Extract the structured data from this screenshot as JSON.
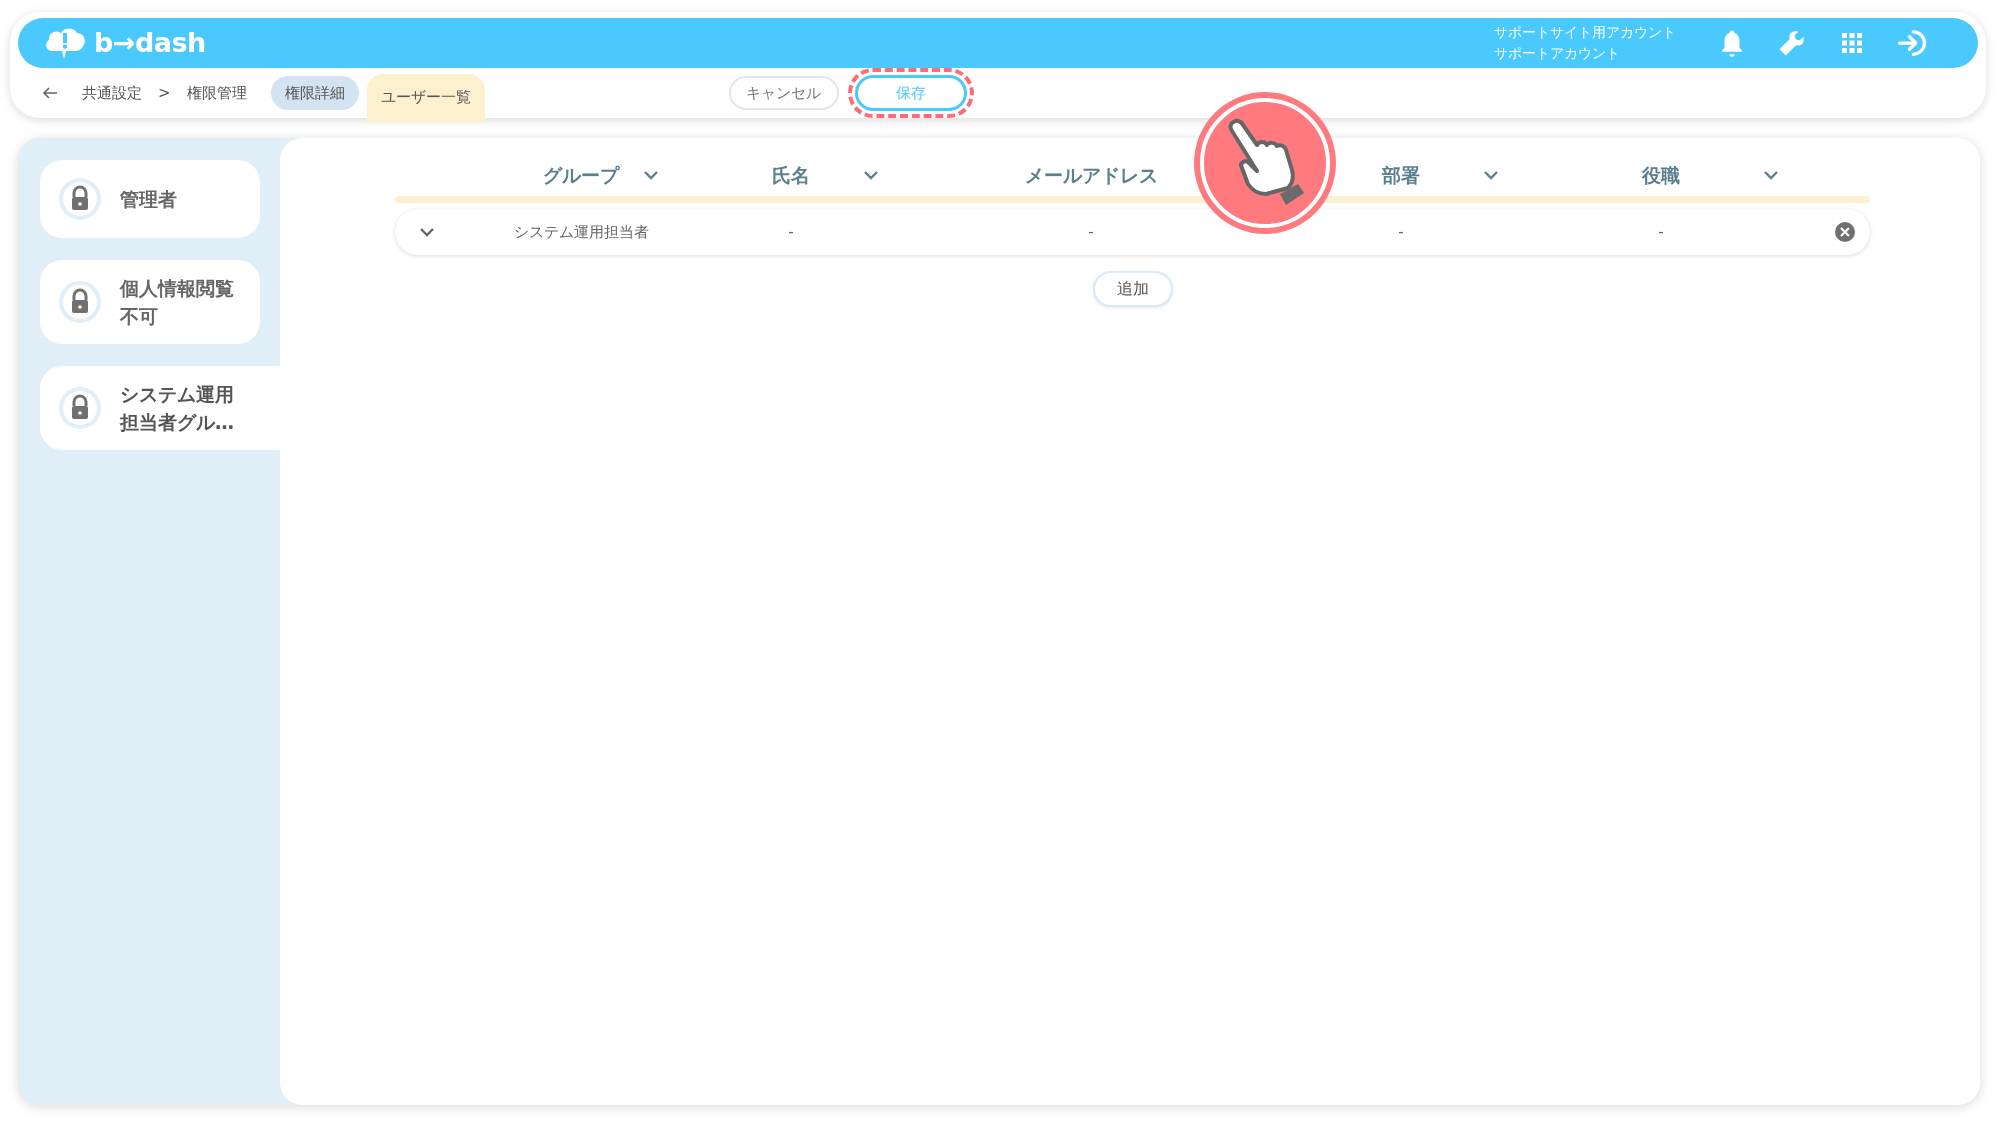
{
  "header": {
    "logo_text": "b→dash",
    "account_lines": [
      "サポートサイト用アカウント",
      "サポートアカウント"
    ]
  },
  "breadcrumb": {
    "items": [
      "共通設定",
      "権限管理"
    ],
    "separator": ">"
  },
  "tabs": [
    {
      "label": "権限詳細",
      "selected": false
    },
    {
      "label": "ユーザー一覧",
      "selected": true
    }
  ],
  "actions": [
    {
      "label": "キャンセル",
      "kind": "cancel",
      "highlighted": false
    },
    {
      "label": "保存",
      "kind": "save",
      "highlighted": true
    }
  ],
  "sidebar": {
    "items": [
      {
        "label": "管理者",
        "selected": false
      },
      {
        "label": "個人情報閲覧不可",
        "selected": false
      },
      {
        "label": "システム運用担当者グル…",
        "selected": true
      }
    ]
  },
  "table": {
    "columns": [
      {
        "label": "グループ",
        "sort_icon": true
      },
      {
        "label": "氏名",
        "sort_icon": true
      },
      {
        "label": "メールアドレス",
        "sort_icon": false
      },
      {
        "label": "部署",
        "sort_icon": true
      },
      {
        "label": "役職",
        "sort_icon": true
      }
    ],
    "rows": [
      {
        "cells": [
          "システム運用担当者",
          "-",
          "-",
          "-",
          "-"
        ]
      }
    ]
  },
  "add_button": {
    "label": "追加"
  }
}
